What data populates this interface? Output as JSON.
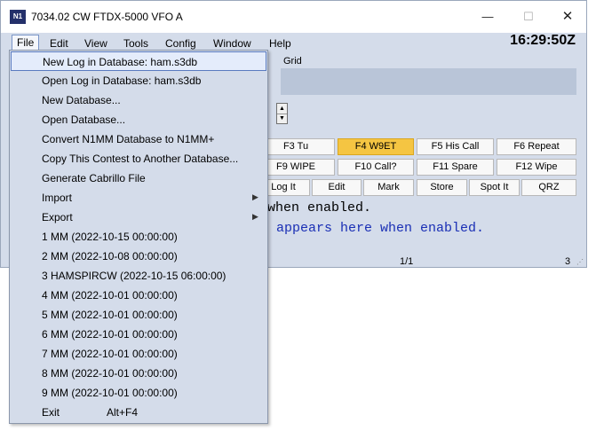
{
  "window": {
    "title": "7034.02 CW FTDX-5000 VFO A",
    "icon_text": "N1",
    "controls": {
      "minimize": "—",
      "maximize": "☐",
      "close": "✕"
    }
  },
  "menubar": {
    "items": [
      "File",
      "Edit",
      "View",
      "Tools",
      "Config",
      "Window",
      "Help"
    ],
    "active": "File"
  },
  "clock": "16:29:50Z",
  "grid_label": "Grid",
  "fkeys": {
    "row1": [
      "F3 Tu",
      "F4 W9ET",
      "F5 His Call",
      "F6 Repeat"
    ],
    "row2": [
      "F9 WIPE",
      "F10 Call?",
      "F11 Spare",
      "F12 Wipe"
    ],
    "row3": [
      "Log It",
      "Edit",
      "Mark",
      "Store",
      "Spot It",
      "QRZ"
    ],
    "highlighted": "F4 W9ET",
    "highlight_color": "#f5c542"
  },
  "messages": {
    "line1": "when enabled.",
    "line2": "appears here when enabled."
  },
  "status": {
    "page": "1/1",
    "count": "3"
  },
  "file_menu": {
    "items": [
      {
        "label": "New Log in Database: ham.s3db",
        "selected": true
      },
      {
        "label": "Open Log in Database: ham.s3db"
      },
      {
        "label": "New Database..."
      },
      {
        "label": "Open Database..."
      },
      {
        "label": "Convert N1MM Database to N1MM+"
      },
      {
        "label": "Copy This Contest to Another Database..."
      },
      {
        "label": "Generate Cabrillo File"
      },
      {
        "label": "Import",
        "submenu": true
      },
      {
        "label": "Export",
        "submenu": true
      },
      {
        "label": "1 MM (2022-10-15 00:00:00)"
      },
      {
        "label": "2 MM (2022-10-08 00:00:00)"
      },
      {
        "label": "3 HAMSPIRCW (2022-10-15 06:00:00)"
      },
      {
        "label": "4 MM (2022-10-01 00:00:00)"
      },
      {
        "label": "5 MM (2022-10-01 00:00:00)"
      },
      {
        "label": "6 MM (2022-10-01 00:00:00)"
      },
      {
        "label": "7 MM (2022-10-01 00:00:00)"
      },
      {
        "label": "8 MM (2022-10-01 00:00:00)"
      },
      {
        "label": "9 MM (2022-10-01 00:00:00)"
      },
      {
        "label": "Exit",
        "shortcut": "Alt+F4"
      }
    ]
  }
}
